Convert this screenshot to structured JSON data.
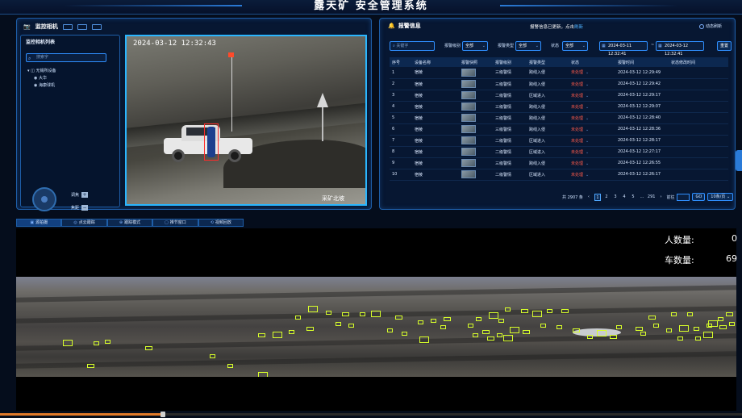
{
  "header": {
    "title": "露天矿 安全管理系统"
  },
  "camera_panel": {
    "title": "监控相机",
    "list_title": "监控相机列表",
    "search_placeholder": "搜索字",
    "tree_root": "无锡所设备",
    "tree_children": [
      "大华",
      "海康球机"
    ],
    "zoom_label": "调焦",
    "focus_label": "焦距",
    "video_osd_time": "2024-03-12 12:32:43",
    "video_osd_name": "采矿北坡"
  },
  "alarm_panel": {
    "title": "报警信息",
    "notice_text": "报警信息已更新，点击",
    "notice_link": "刷新",
    "auto_refresh": "动态刷新",
    "filters": {
      "keyword_placeholder": "关键字",
      "level_label": "报警级别",
      "level_value": "全部",
      "type_label": "报警类型",
      "type_value": "全部",
      "status_label": "状态",
      "status_value": "全部",
      "date_start": "2024-03-11 12:32:41",
      "date_sep": "~",
      "date_end": "2024-03-12 12:32:41",
      "reset_label": "重置"
    },
    "columns": [
      "序号",
      "设备名称",
      "报警快照",
      "报警级别",
      "报警类型",
      "状态",
      "报警时间",
      "状态修改时间"
    ],
    "rows": [
      {
        "no": "1",
        "device": "宿棱",
        "level": "三级警情",
        "type": "跨线入侵",
        "status": "未处理",
        "time": "2024-03-12 12:29:49"
      },
      {
        "no": "2",
        "device": "宿棱",
        "level": "三级警情",
        "type": "跨线入侵",
        "status": "未处理",
        "time": "2024-03-12 12:29:42"
      },
      {
        "no": "3",
        "device": "宿棱",
        "level": "二级警情",
        "type": "区域进入",
        "status": "未处理",
        "time": "2024-03-12 12:29:17"
      },
      {
        "no": "4",
        "device": "宿棱",
        "level": "三级警情",
        "type": "跨线入侵",
        "status": "未处理",
        "time": "2024-03-12 12:29:07"
      },
      {
        "no": "5",
        "device": "宿棱",
        "level": "三级警情",
        "type": "跨线入侵",
        "status": "未处理",
        "time": "2024-03-12 12:28:40"
      },
      {
        "no": "6",
        "device": "宿棱",
        "level": "三级警情",
        "type": "跨线入侵",
        "status": "未处理",
        "time": "2024-03-12 12:28:36"
      },
      {
        "no": "7",
        "device": "宿棱",
        "level": "二级警情",
        "type": "区域进入",
        "status": "未处理",
        "time": "2024-03-12 12:28:17"
      },
      {
        "no": "8",
        "device": "宿棱",
        "level": "二级警情",
        "type": "区域进入",
        "status": "未处理",
        "time": "2024-03-12 12:27:17"
      },
      {
        "no": "9",
        "device": "宿棱",
        "level": "三级警情",
        "type": "跨线入侵",
        "status": "未处理",
        "time": "2024-03-12 12:26:55"
      },
      {
        "no": "10",
        "device": "宿棱",
        "level": "二级警情",
        "type": "区域进入",
        "status": "未处理",
        "time": "2024-03-12 12:26:17"
      }
    ],
    "pager": {
      "total": "共 2907 条",
      "prev": "‹",
      "pages": [
        "1",
        "2",
        "3",
        "4",
        "5",
        "...",
        "291"
      ],
      "next": "›",
      "goto_label": "前往",
      "go_label": "GO",
      "page_size": "10条/页"
    }
  },
  "bottom_tabs": [
    "源拍摄",
    "点云跟踪",
    "跟踪模式",
    "推节窗口",
    "视频回放"
  ],
  "counts": {
    "person_label": "人数量:",
    "person_value": "0",
    "vehicle_label": "车数量:",
    "vehicle_value": "69"
  },
  "playback": {
    "progress": 0.22
  },
  "colors": {
    "accent": "#2ab6ff",
    "detection": "#d8ff2a",
    "alarm_status": "#ff5a4a"
  }
}
